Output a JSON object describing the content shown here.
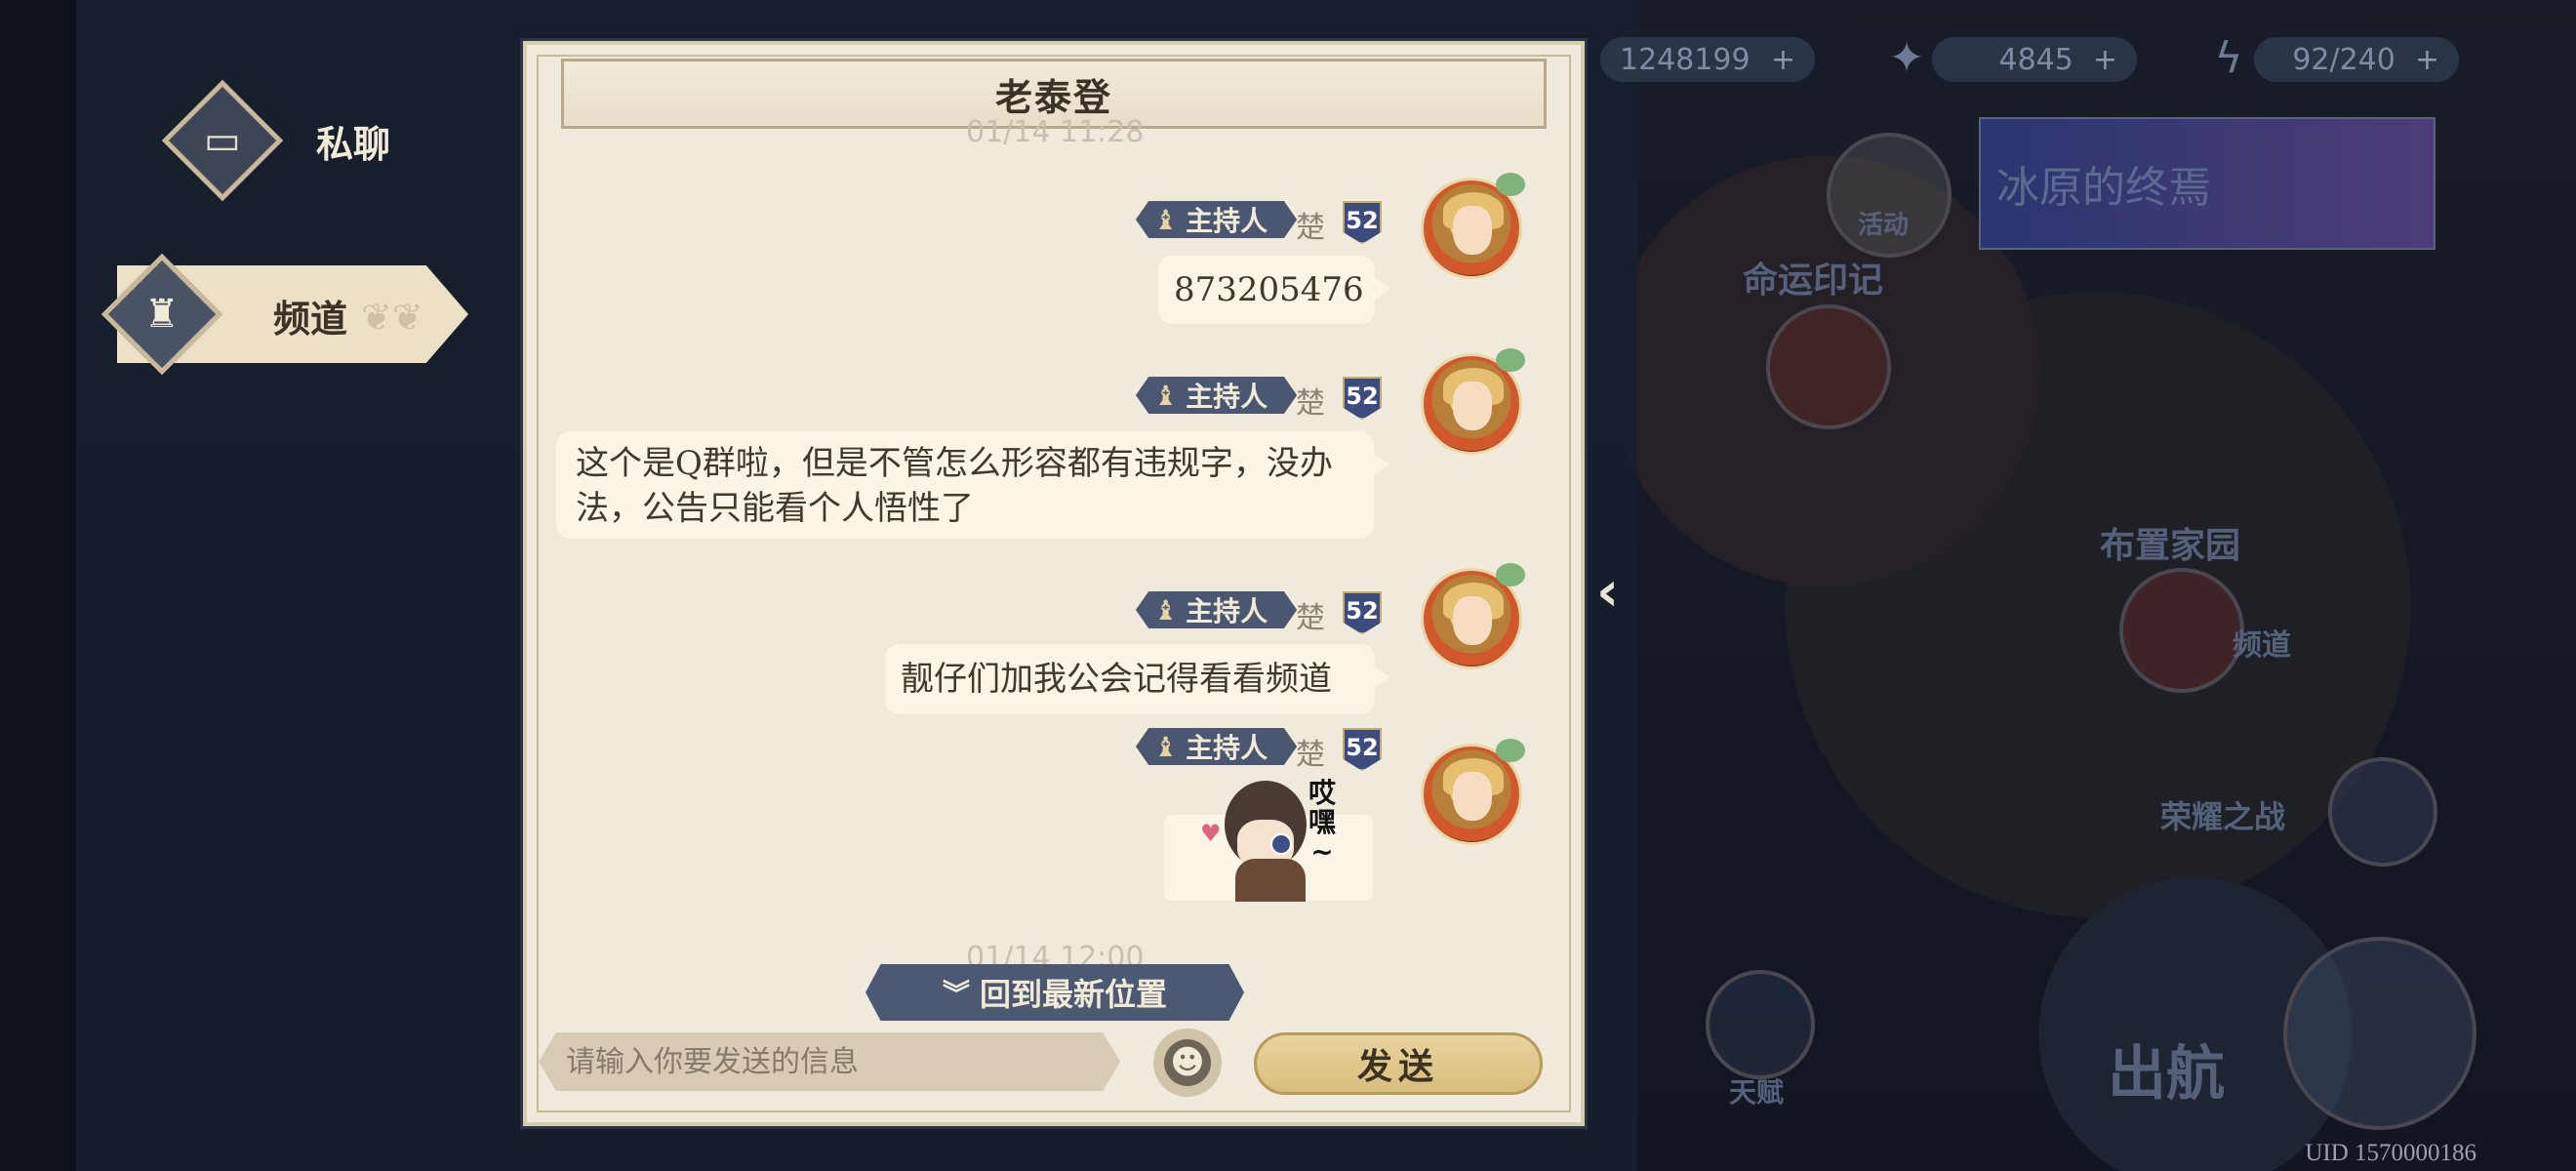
{
  "resources": {
    "gold": "1248199",
    "gems": "4845",
    "energy": "92/240",
    "plus": "+"
  },
  "background": {
    "activity_label": "活动",
    "banner_text": "冰原的终焉",
    "fate_label": "命运印记",
    "home_label": "布置家园",
    "channel_label": "频道",
    "honor_label": "荣耀之战",
    "talent_label": "天赋",
    "sail_label": "出航"
  },
  "uid": "UID 1570000186",
  "sidebar": {
    "private_label": "私聊",
    "channel_label": "频道"
  },
  "chat": {
    "title": "老泰登",
    "top_timestamp": "01/14 11:28",
    "bottom_timestamp": "01/14 12:00",
    "messages": [
      {
        "badge": "主持人",
        "name": "楚",
        "level": "52",
        "text": "873205476"
      },
      {
        "badge": "主持人",
        "name": "楚",
        "level": "52",
        "text": "这个是Q群啦，但是不管怎么形容都有违规字，没办法，公告只能看个人悟性了"
      },
      {
        "badge": "主持人",
        "name": "楚",
        "level": "52",
        "text": "靓仔们加我公会记得看看频道"
      },
      {
        "badge": "主持人",
        "name": "楚",
        "level": "52",
        "sticker_text": "哎嘿~"
      }
    ],
    "jump_label": "回到最新位置",
    "input_placeholder": "请输入你要发送的信息",
    "send_label": "发送"
  }
}
